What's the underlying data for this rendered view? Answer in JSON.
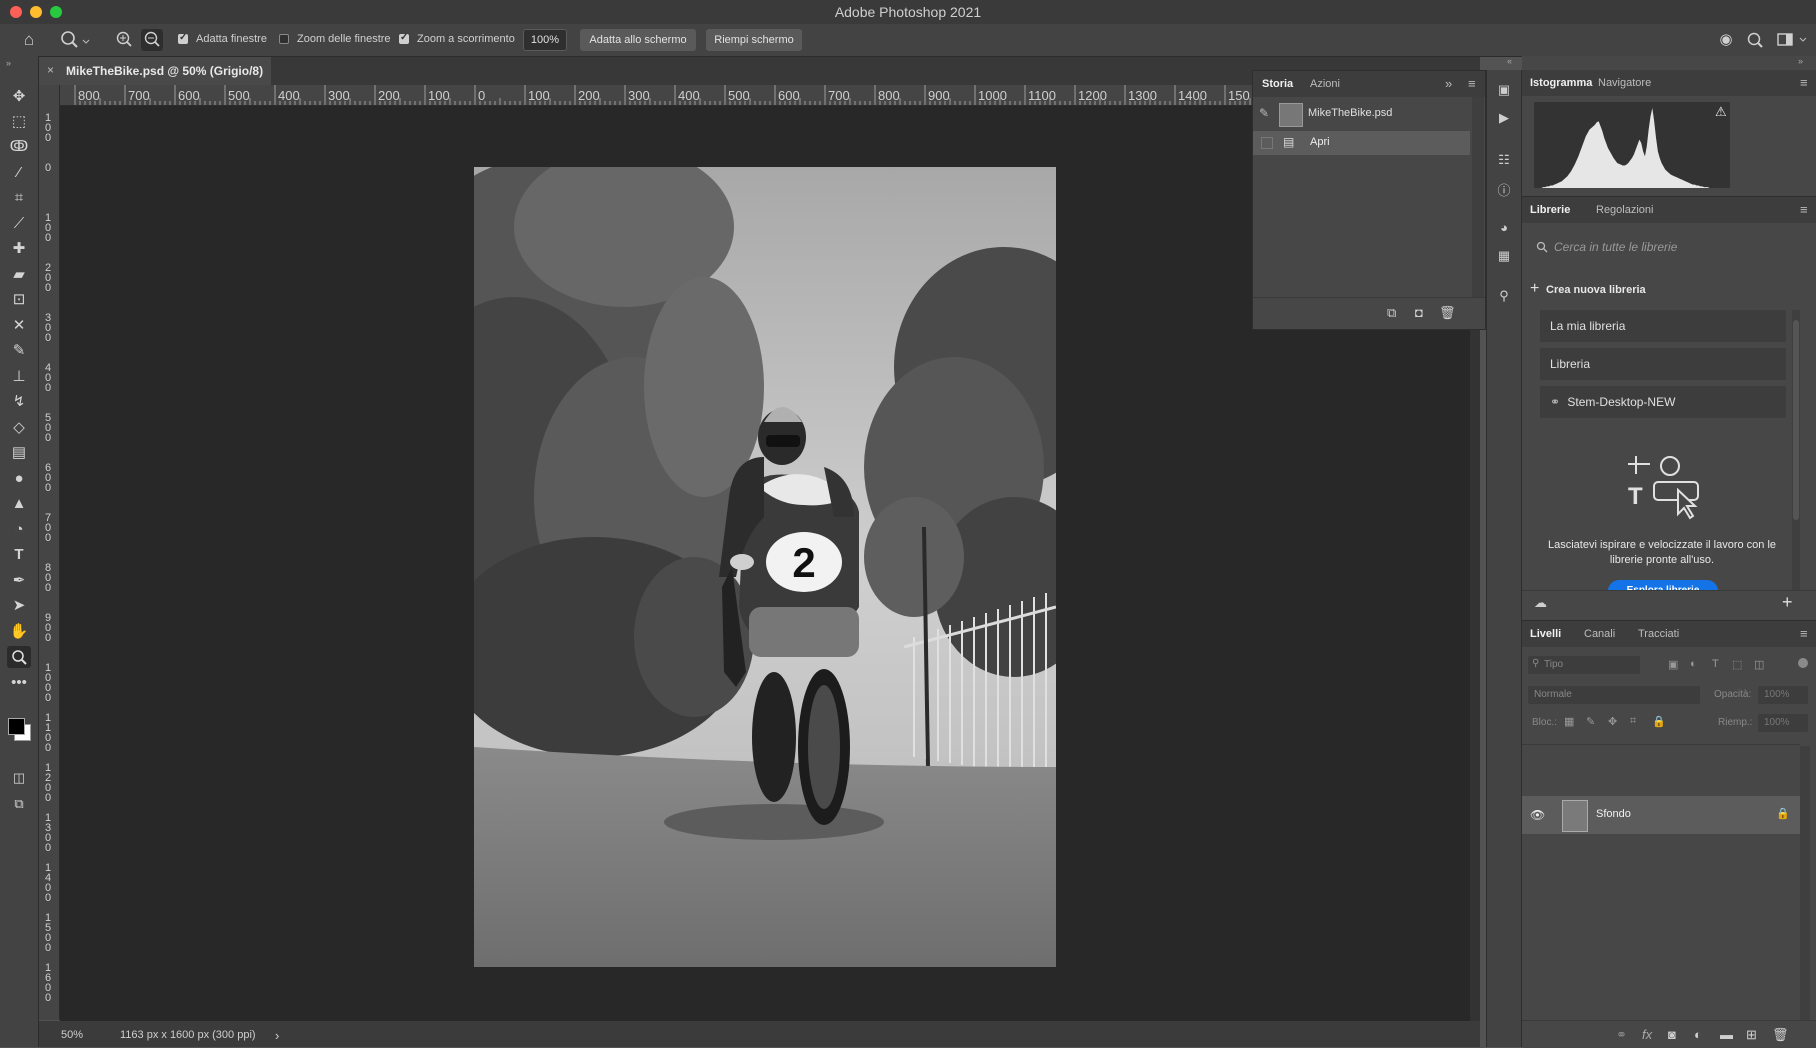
{
  "app": {
    "title": "Adobe Photoshop 2021",
    "window_buttons": {
      "close": "#fe5f57",
      "minimize": "#febc2e",
      "maximize": "#28c840"
    }
  },
  "options_bar": {
    "tool_icon": "zoom-icon",
    "checkboxes": [
      {
        "label": "Adatta finestre",
        "checked": true
      },
      {
        "label": "Zoom delle finestre",
        "checked": false
      },
      {
        "label": "Zoom a scorrimento",
        "checked": true
      }
    ],
    "zoom_value": "100%",
    "buttons": [
      "Adatta allo schermo",
      "Riempi schermo"
    ]
  },
  "document": {
    "tab_title": "MikeTheBike.psd @ 50% (Grigio/8)",
    "close": "×",
    "race_number": "2"
  },
  "rulers": {
    "horizontal": [
      "800",
      "700",
      "600",
      "500",
      "400",
      "300",
      "200",
      "100",
      "0",
      "100",
      "200",
      "300",
      "400",
      "500",
      "600",
      "700",
      "800",
      "900",
      "1000",
      "1100",
      "1200",
      "1300",
      "1400",
      "150"
    ],
    "vertical": [
      "100",
      "0",
      "100",
      "200",
      "300",
      "400",
      "500",
      "600",
      "700",
      "800",
      "900",
      "1000",
      "1100",
      "1200",
      "1300",
      "1400",
      "1500",
      "1600"
    ]
  },
  "status": {
    "zoom": "50%",
    "doc_size": "1163 px x 1600 px (300 ppi)",
    "arrow": "›"
  },
  "history_panel": {
    "tabs": [
      "Storia",
      "Azioni"
    ],
    "snapshot": "MikeTheBike.psd",
    "steps": [
      "Apri"
    ]
  },
  "histogram_panel": {
    "tabs": [
      "Istogramma",
      "Navigatore"
    ],
    "warning": "⚠",
    "levels": [
      0,
      0,
      0,
      0,
      0,
      1,
      1,
      2,
      2,
      3,
      3,
      4,
      5,
      6,
      7,
      8,
      10,
      12,
      14,
      17,
      20,
      24,
      28,
      33,
      38,
      44,
      50,
      56,
      62,
      66,
      70,
      72,
      74,
      76,
      79,
      80,
      74,
      68,
      60,
      54,
      48,
      44,
      40,
      36,
      33,
      30,
      29,
      28,
      27,
      27,
      28,
      30,
      33,
      36,
      40,
      46,
      52,
      58,
      54,
      44,
      38,
      50,
      70,
      86,
      96,
      80,
      60,
      44,
      36,
      30,
      26,
      22,
      20,
      18,
      16,
      15,
      14,
      13,
      12,
      11,
      10,
      9,
      8,
      7,
      6,
      5,
      4,
      4,
      3,
      3,
      2,
      2,
      1,
      1,
      1,
      0,
      0,
      0,
      0,
      0,
      0,
      0,
      0,
      0,
      0,
      0
    ]
  },
  "libraries_panel": {
    "tabs": [
      "Librerie",
      "Regolazioni"
    ],
    "search_placeholder": "Cerca in tutte le librerie",
    "create": "Crea nuova libreria",
    "items": [
      "La mia libreria",
      "Libreria",
      "Stem-Desktop-NEW"
    ],
    "promo_text": "Lasciatevi ispirare e velocizzate il lavoro con le librerie pronte all'uso.",
    "promo_button": "Esplora librerie",
    "add": "+"
  },
  "layers_panel": {
    "tabs": [
      "Livelli",
      "Canali",
      "Tracciati"
    ],
    "filter_placeholder": "Tipo",
    "blend_mode": "Normale",
    "opacity_label": "Opacità:",
    "opacity_value": "100%",
    "lock_label": "Bloc.:",
    "fill_label": "Riemp.:",
    "fill_value": "100%",
    "layers": [
      {
        "name": "Sfondo",
        "visible": true,
        "locked": true
      }
    ],
    "footer_icons": [
      "link-icon",
      "fx-icon",
      "mask-icon",
      "adjustment-icon",
      "folder-icon",
      "new-layer-icon",
      "trash-icon"
    ],
    "footer_glyphs": [
      "⚭",
      "fx",
      "◙",
      "◐",
      "▬",
      "⊞",
      "🗑"
    ]
  },
  "colors": {
    "canvas_bg": "#282828",
    "panel_bg": "#474747",
    "accent_blue": "#1473e6"
  }
}
